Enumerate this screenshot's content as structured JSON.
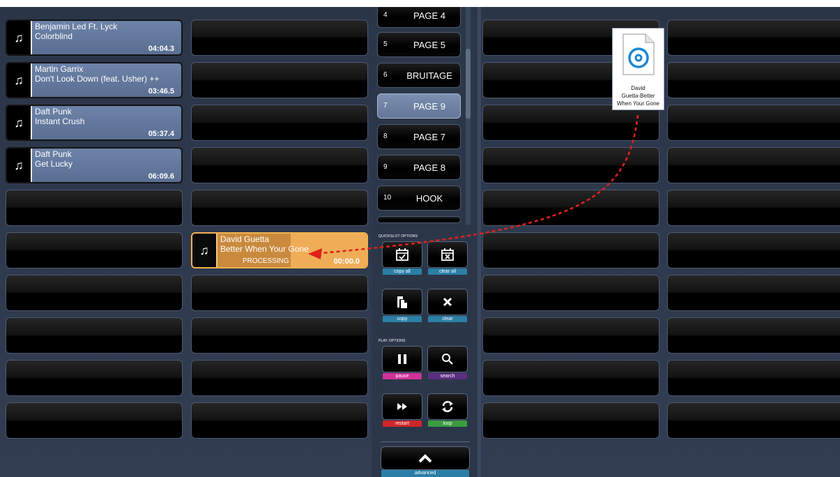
{
  "colors": {
    "background": "#2e3a4f",
    "slot_filled": "#6d83a8",
    "slot_processing": "#f0ad57",
    "drag_arrow": "#e0201b"
  },
  "slots": {
    "col1": [
      {
        "artist": "Benjamin Led Ft. Lyck",
        "title": "Colorblind",
        "time": "04:04.3",
        "icon": "music-note-icon"
      },
      {
        "artist": "Martin Garrix",
        "title": "Don't Look Down (feat. Usher) ++",
        "time": "03:46.5",
        "icon": "music-note-icon"
      },
      {
        "artist": "Daft Punk",
        "title": "Instant Crush",
        "time": "05:37.4",
        "icon": "music-note-icon"
      },
      {
        "artist": "Daft Punk",
        "title": "Get Lucky",
        "time": "06:09.6",
        "icon": "music-note-icon"
      }
    ],
    "processing": {
      "artist": "David Guetta",
      "title": "Better When Your Gone",
      "status": "PROCESSING",
      "time": "00:00.0",
      "icon": "music-note-icon"
    }
  },
  "pages": [
    {
      "num": "4",
      "label": "PAGE 4"
    },
    {
      "num": "5",
      "label": "PAGE 5"
    },
    {
      "num": "6",
      "label": "BRUITAGE"
    },
    {
      "num": "7",
      "label": "PAGE 9",
      "active": true
    },
    {
      "num": "8",
      "label": "PAGE 7"
    },
    {
      "num": "9",
      "label": "PAGE 8"
    },
    {
      "num": "10",
      "label": "HOOK"
    }
  ],
  "quickslot_options": {
    "heading": "QUICKSLOT OPTIONS",
    "copy_all": "copy all",
    "clear_all": "clear all",
    "copy": "copy",
    "clear": "clear"
  },
  "play_options": {
    "heading": "PLAY OPTIONS",
    "pause": "pause",
    "search": "search",
    "restart": "restart",
    "loop": "loop"
  },
  "advanced": {
    "label": "advanced"
  },
  "drag_file": {
    "line1": "David",
    "line2": "Guetta-Better",
    "line3": "When Your Gone",
    "icon": "audio-file-icon"
  }
}
